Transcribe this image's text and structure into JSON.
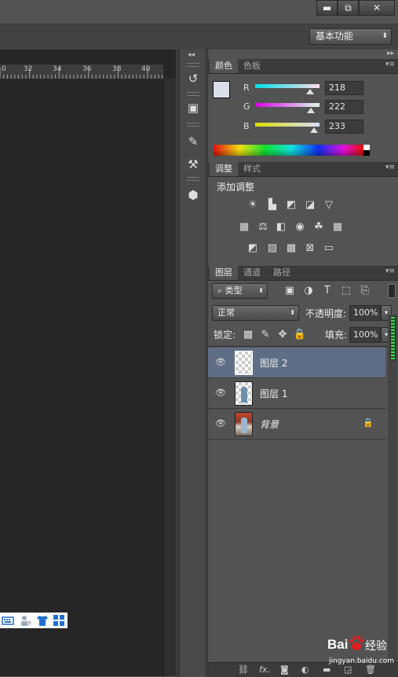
{
  "window": {
    "minimize": "▬",
    "restore": "⧉",
    "close": "✕"
  },
  "workspace": {
    "value": "基本功能"
  },
  "ruler": {
    "ticks": [
      "0",
      "32",
      "34",
      "36",
      "38",
      "40"
    ]
  },
  "toolstrip": {
    "items": [
      "history-icon",
      "3d-layers-icon",
      "brush-presets-icon",
      "tool-presets-icon",
      "3d-cube-icon"
    ]
  },
  "color_panel": {
    "tabs": [
      "颜色",
      "色板"
    ],
    "channels": [
      {
        "label": "R",
        "value": "218",
        "level": 0.855
      },
      {
        "label": "G",
        "value": "222",
        "level": 0.871
      },
      {
        "label": "B",
        "value": "233",
        "level": 0.914
      }
    ],
    "foreground": "#dadee9",
    "background": "#ffffff"
  },
  "adjustments_panel": {
    "tabs": [
      "调整",
      "样式"
    ],
    "title": "添加调整",
    "icons": [
      [
        "brightness-icon",
        "levels-icon",
        "curves-icon",
        "exposure-icon",
        "vibrance-icon"
      ],
      [
        "hue-saturation-icon",
        "color-balance-icon",
        "black-white-icon",
        "photo-filter-icon",
        "channel-mixer-icon",
        "color-lookup-icon"
      ],
      [
        "invert-icon",
        "posterize-icon",
        "threshold-icon",
        "selective-color-icon",
        "gradient-map-icon"
      ]
    ]
  },
  "layers_panel": {
    "tabs": [
      "图层",
      "通道",
      "路径"
    ],
    "filter_label": "类型",
    "blend_mode": "正常",
    "opacity_label": "不透明度:",
    "opacity_value": "100%",
    "lock_label": "锁定:",
    "fill_label": "填充:",
    "fill_value": "100%",
    "layers": [
      {
        "name": "图层 2",
        "selected": true,
        "locked": false
      },
      {
        "name": "图层 1",
        "selected": false,
        "locked": false
      },
      {
        "name": "背景",
        "selected": false,
        "locked": true
      }
    ],
    "footer_icons": [
      "link-icon",
      "fx-icon",
      "mask-icon",
      "adjustment-layer-icon",
      "group-icon",
      "new-layer-icon",
      "delete-icon"
    ]
  },
  "watermark": {
    "brand": "Bai",
    "brand2": "经验",
    "url": "jingyan.baidu.com"
  }
}
